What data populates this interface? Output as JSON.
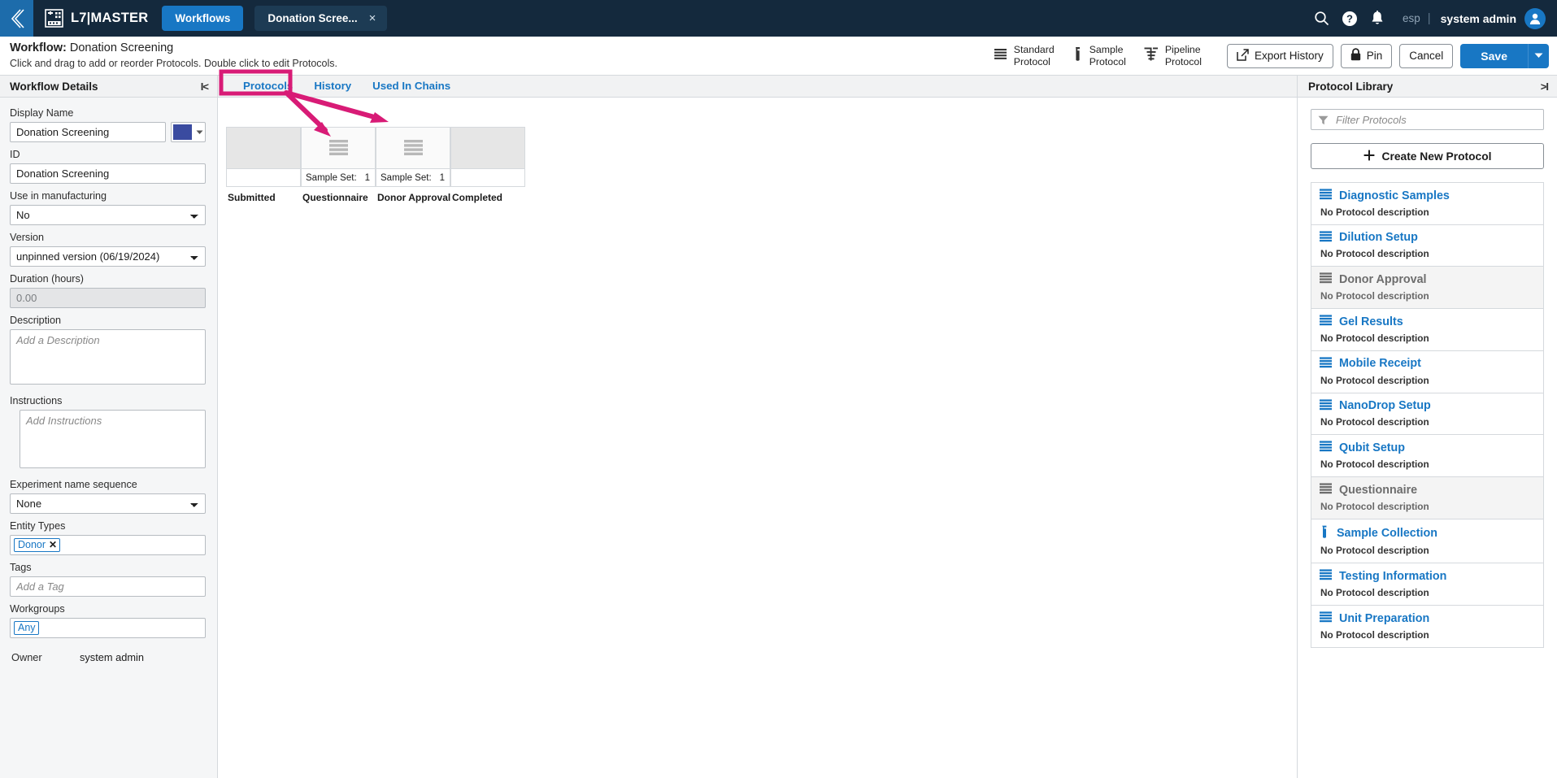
{
  "topnav": {
    "back_icon": "chevron-left-icon",
    "brand_icon": "l7-logo-icon",
    "brand": "L7|MASTER",
    "workflows_tab": "Workflows",
    "doc_tab": "Donation Scree...",
    "doc_tab_close": "×",
    "search_icon": "search-icon",
    "help_icon": "help-icon",
    "bell_icon": "notification-bell-icon",
    "language": "esp",
    "separator": "|",
    "username": "system admin",
    "avatar_icon": "user-avatar-icon"
  },
  "header": {
    "title_prefix": "Workflow:",
    "title_name": "Donation Screening",
    "subtitle": "Click and drag to add or reorder Protocols. Double click to edit Protocols.",
    "protocol_types": [
      {
        "icon": "standard-protocol-icon",
        "line1": "Standard",
        "line2": "Protocol"
      },
      {
        "icon": "sample-protocol-icon",
        "line1": "Sample",
        "line2": "Protocol"
      },
      {
        "icon": "pipeline-protocol-icon",
        "line1": "Pipeline",
        "line2": "Protocol"
      }
    ],
    "export_history": "Export History",
    "export_icon": "external-link-icon",
    "pin": "Pin",
    "pin_icon": "lock-icon",
    "cancel": "Cancel",
    "save": "Save",
    "save_caret_icon": "chevron-down-icon",
    "accent_color": "#1877c4"
  },
  "sidebar": {
    "title": "Workflow Details",
    "collapse_icon": "collapse-left-icon",
    "fields": {
      "display_name_label": "Display Name",
      "display_name_value": "Donation Screening",
      "color_value": "#3a4ba0",
      "color_caret_icon": "caret-down-icon",
      "id_label": "ID",
      "id_value": "Donation Screening",
      "use_in_manufacturing_label": "Use in manufacturing",
      "use_in_manufacturing_value": "No",
      "version_label": "Version",
      "version_value": "unpinned version (06/19/2024)",
      "duration_label": "Duration (hours)",
      "duration_value": "0.00",
      "description_label": "Description",
      "description_placeholder": "Add a Description",
      "instructions_label": "Instructions",
      "instructions_placeholder": "Add Instructions",
      "experiment_name_sequence_label": "Experiment name sequence",
      "experiment_name_sequence_value": "None",
      "entity_types_label": "Entity Types",
      "entity_type_chip": "Donor",
      "entity_type_chip_remove": "✕",
      "tags_label": "Tags",
      "tags_placeholder": "Add a Tag",
      "workgroups_label": "Workgroups",
      "workgroup_chip": "Any",
      "owner_label": "Owner",
      "owner_value": "system admin"
    }
  },
  "center": {
    "tabs": [
      {
        "label": "Protocols",
        "active": true
      },
      {
        "label": "History",
        "active": false
      },
      {
        "label": "Used In Chains",
        "active": false
      }
    ],
    "flow_nodes": [
      {
        "label": "Submitted",
        "icon": "",
        "meta_label": "",
        "meta_value": "",
        "empty": true
      },
      {
        "label": "Questionnaire",
        "icon": "standard-protocol-icon",
        "meta_label": "Sample Set:",
        "meta_value": "1",
        "empty": false
      },
      {
        "label": "Donor Approval",
        "icon": "standard-protocol-icon",
        "meta_label": "Sample Set:",
        "meta_value": "1",
        "empty": false
      },
      {
        "label": "Completed",
        "icon": "",
        "meta_label": "",
        "meta_value": "",
        "empty": true
      }
    ]
  },
  "library": {
    "title": "Protocol Library",
    "expand_icon": "collapse-right-icon",
    "filter_placeholder": "Filter Protocols",
    "filter_icon": "filter-icon",
    "create_button": "Create New Protocol",
    "create_icon": "plus-icon",
    "no_description": "No Protocol description",
    "protocols": [
      {
        "name": "Diagnostic Samples",
        "icon": "standard-protocol-icon",
        "desc": "No Protocol description",
        "used": false
      },
      {
        "name": "Dilution Setup",
        "icon": "standard-protocol-icon",
        "desc": "No Protocol description",
        "used": false
      },
      {
        "name": "Donor Approval",
        "icon": "standard-protocol-icon",
        "desc": "No Protocol description",
        "used": true
      },
      {
        "name": "Gel Results",
        "icon": "standard-protocol-icon",
        "desc": "No Protocol description",
        "used": false
      },
      {
        "name": "Mobile Receipt",
        "icon": "standard-protocol-icon",
        "desc": "No Protocol description",
        "used": false
      },
      {
        "name": "NanoDrop Setup",
        "icon": "standard-protocol-icon",
        "desc": "No Protocol description",
        "used": false
      },
      {
        "name": "Qubit Setup",
        "icon": "standard-protocol-icon",
        "desc": "No Protocol description",
        "used": false
      },
      {
        "name": "Questionnaire",
        "icon": "standard-protocol-icon",
        "desc": "No Protocol description",
        "used": true
      },
      {
        "name": "Sample Collection",
        "icon": "sample-protocol-icon",
        "desc": "No Protocol description",
        "used": false
      },
      {
        "name": "Testing Information",
        "icon": "standard-protocol-icon",
        "desc": "No Protocol description",
        "used": false
      },
      {
        "name": "Unit Preparation",
        "icon": "standard-protocol-icon",
        "desc": "No Protocol description",
        "used": false
      }
    ]
  },
  "annotation": {
    "color": "#d81b76",
    "highlight_target": "Protocols",
    "arrow_count": 2
  }
}
